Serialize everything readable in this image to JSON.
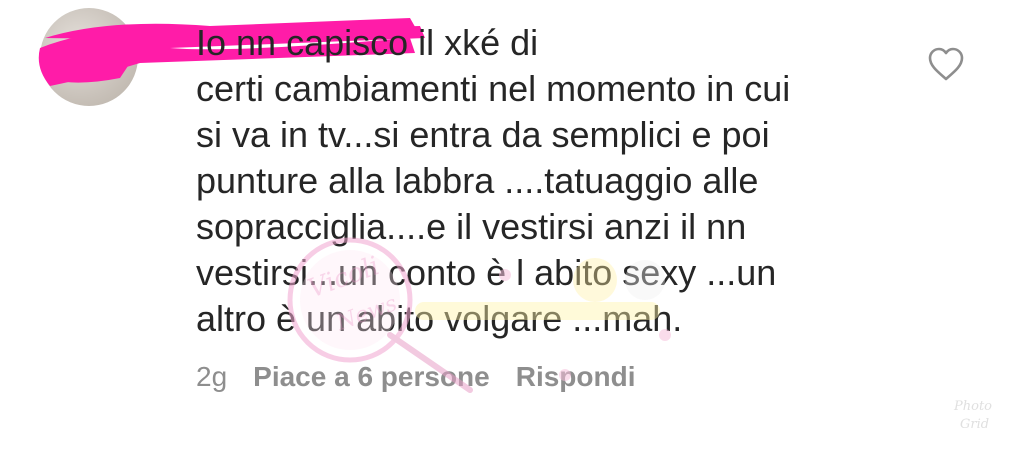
{
  "comment": {
    "text": "Io nn capisco il  xké di\ncerti  cambiamenti nel momento in cui\nsi va in tv...si entra da semplici e poi\npunture alla labbra ....tatuaggio alle\nsopracciglia....e il vestirsi anzi il nn\nvestirsi...un conto è  l abito sexy ...un\naltro è  un abito volgare ...mah.",
    "time": "2g",
    "likes_label": "Piace a 6 persone",
    "reply_label": "Rispondi"
  },
  "icons": {
    "like": "heart-outline-icon",
    "avatar": "avatar"
  },
  "colors": {
    "text": "#262626",
    "meta": "#8e8e8e",
    "redaction": "#ff1ca8",
    "watermark": "#e8a0c8"
  }
}
